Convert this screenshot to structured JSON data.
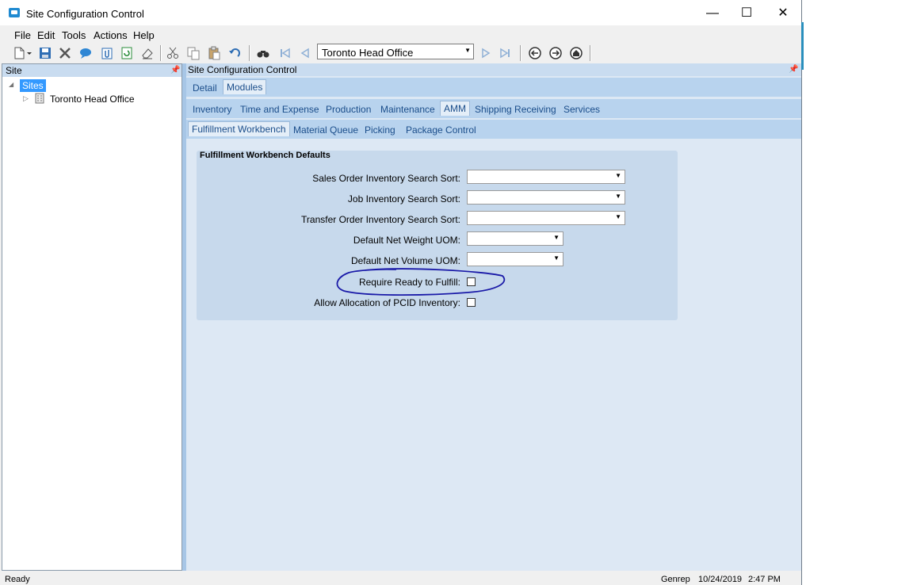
{
  "window": {
    "title": "Site Configuration Control",
    "controls": {
      "minimize": "—",
      "maximize": "☐",
      "close": "✕"
    }
  },
  "menu": [
    "File",
    "Edit",
    "Tools",
    "Actions",
    "Help"
  ],
  "toolbar": {
    "site_combo_value": "Toronto Head Office",
    "icons": [
      "new-icon",
      "save-icon",
      "delete-icon",
      "chat-icon",
      "attach-icon",
      "refresh-icon",
      "clear-icon",
      "cut-icon",
      "copy-icon",
      "paste-icon",
      "undo-icon",
      "find-icon",
      "first-icon",
      "prev-icon",
      "next-icon",
      "last-icon",
      "back-icon",
      "forward-icon",
      "home-icon"
    ]
  },
  "left_panel": {
    "title": "Site",
    "tree": {
      "root": "Sites",
      "child": "Toronto Head Office"
    }
  },
  "right_panel": {
    "title": "Site Configuration Control",
    "tabs_top": [
      "Detail",
      "Modules"
    ],
    "tabs_modules": [
      "Inventory",
      "Time and Expense",
      "Production",
      "Maintenance",
      "AMM",
      "Shipping Receiving",
      "Services"
    ],
    "tabs_amm": [
      "Fulfillment Workbench",
      "Material Queue",
      "Picking",
      "Package Control"
    ],
    "group": {
      "title": "Fulfillment Workbench Defaults",
      "fields": {
        "so_sort": "Sales Order Inventory Search Sort:",
        "job_sort": "Job Inventory Search Sort:",
        "to_sort": "Transfer Order Inventory Search Sort:",
        "net_weight": "Default Net Weight UOM:",
        "net_volume": "Default Net Volume UOM:",
        "require_ready": "Require Ready to Fulfill:",
        "allow_pcid": "Allow Allocation of PCID Inventory:"
      }
    }
  },
  "status": {
    "left": "Ready",
    "user": "Genrep",
    "date": "10/24/2019",
    "time": "2:47 PM"
  },
  "colors": {
    "annotation": "#1a1aa8",
    "tab_text": "#1a4d8a",
    "pane_bg": "#dde8f4"
  }
}
